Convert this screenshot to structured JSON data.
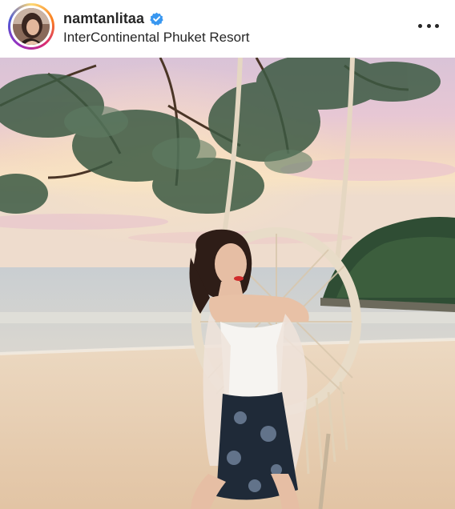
{
  "post": {
    "username": "namtanlitaa",
    "verified": true,
    "location": "InterContinental Phuket Resort"
  },
  "icons": {
    "verified": "verified-badge-icon",
    "more": "more-options-icon"
  },
  "colors": {
    "text": "#262626",
    "verified_blue": "#3897f0"
  }
}
